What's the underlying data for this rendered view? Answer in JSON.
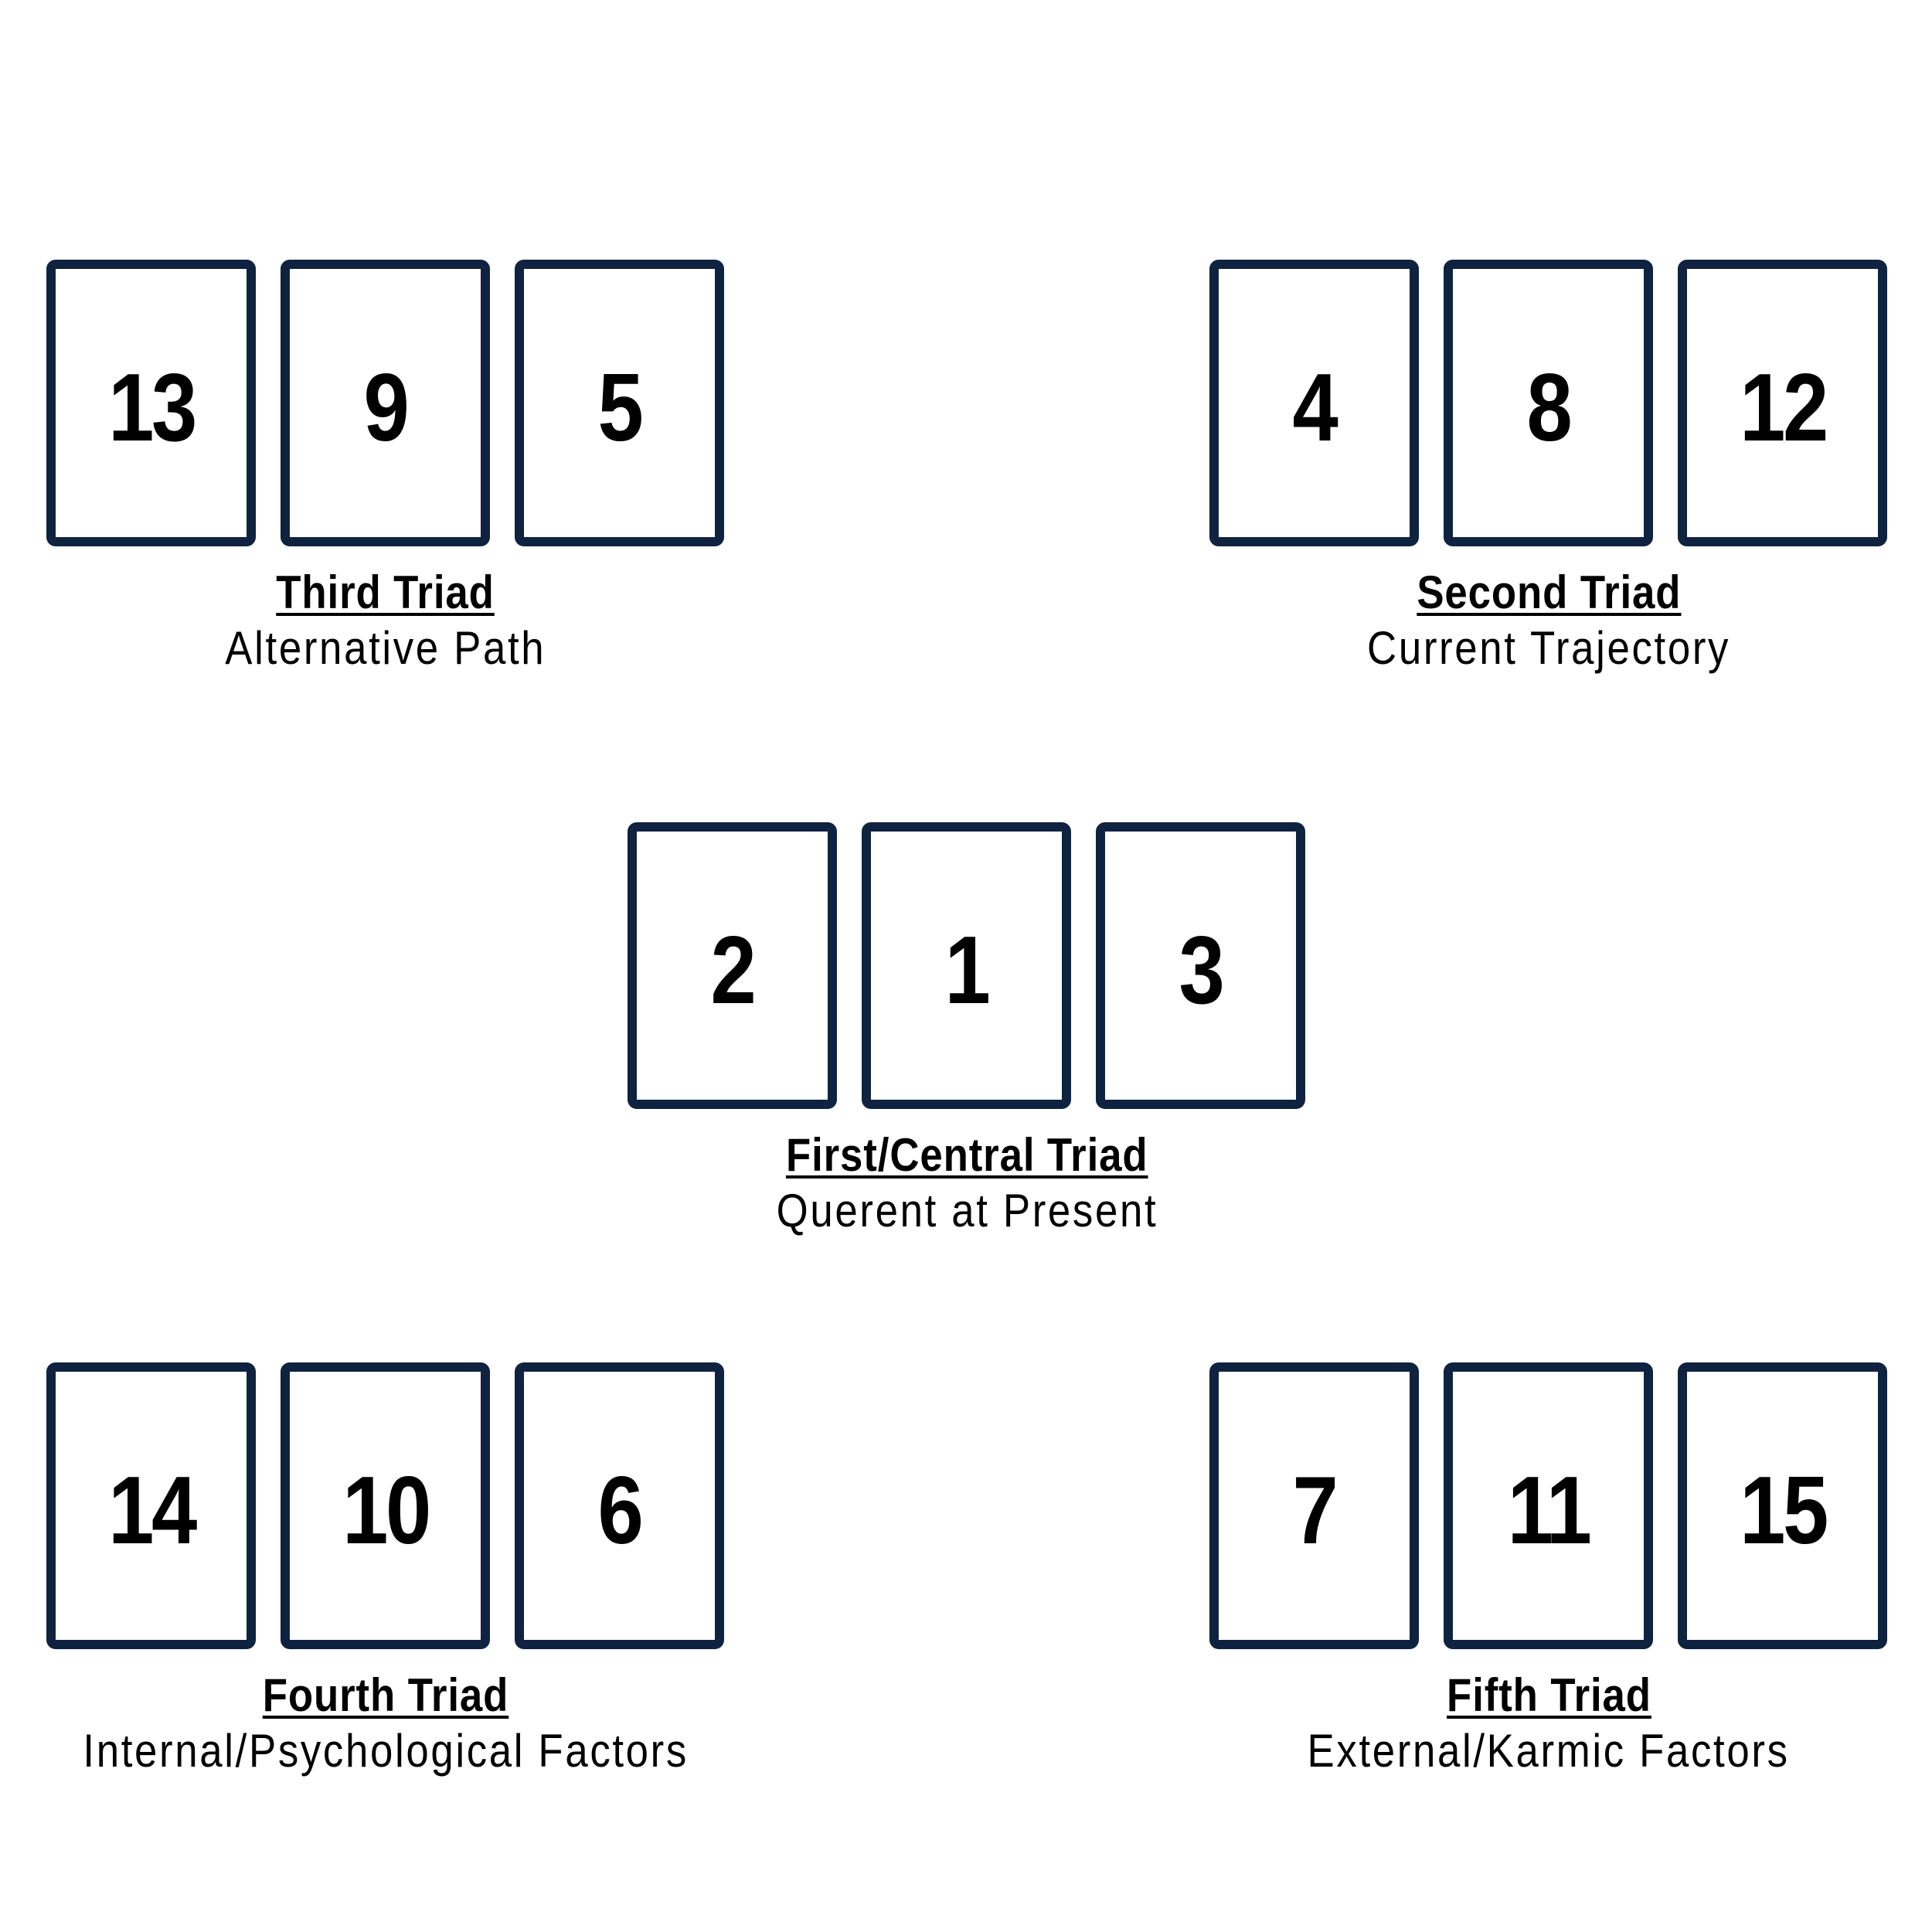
{
  "colors": {
    "card_border": "#0f2340",
    "text": "#000000",
    "background": "#ffffff"
  },
  "groups": [
    {
      "id": "third",
      "title": "Third Triad",
      "subtitle": "Alternative Path",
      "cards": [
        "13",
        "9",
        "5"
      ]
    },
    {
      "id": "second",
      "title": "Second Triad",
      "subtitle": "Current Trajectory",
      "cards": [
        "4",
        "8",
        "12"
      ]
    },
    {
      "id": "first",
      "title": "First/Central Triad",
      "subtitle": "Querent at Present",
      "cards": [
        "2",
        "1",
        "3"
      ]
    },
    {
      "id": "fourth",
      "title": "Fourth Triad",
      "subtitle": "Internal/Psychological Factors",
      "cards": [
        "14",
        "10",
        "6"
      ]
    },
    {
      "id": "fifth",
      "title": "Fifth Triad",
      "subtitle": "External/Karmic Factors",
      "cards": [
        "7",
        "11",
        "15"
      ]
    }
  ]
}
